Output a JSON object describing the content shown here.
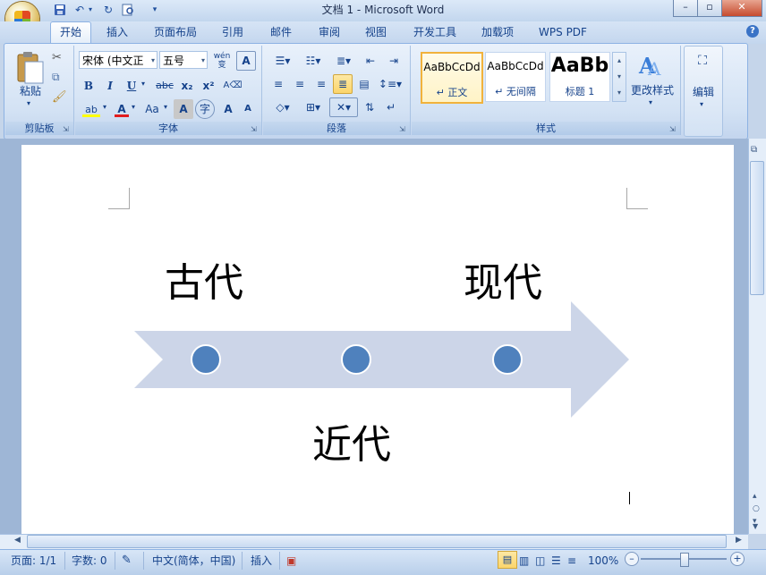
{
  "window": {
    "title": "文档 1 - Microsoft Word",
    "qat": [
      "save-icon",
      "undo-icon",
      "redo-icon",
      "print-preview-icon"
    ],
    "controls": [
      "minimize",
      "maximize",
      "close"
    ]
  },
  "tabs": [
    "开始",
    "插入",
    "页面布局",
    "引用",
    "邮件",
    "审阅",
    "视图",
    "开发工具",
    "加载项",
    "WPS PDF"
  ],
  "active_tab": "开始",
  "ribbon": {
    "clipboard": {
      "paste_label": "粘贴",
      "group_label": "剪贴板"
    },
    "font": {
      "font_name": "宋体 (中文正",
      "font_size": "五号",
      "wen_label": "wén 变",
      "bold": "B",
      "italic": "I",
      "underline": "U",
      "strike": "abc",
      "subscript": "x₂",
      "superscript": "x²",
      "aa_label": "Aa",
      "grow": "A",
      "shrink": "A",
      "group_label": "字体"
    },
    "paragraph": {
      "group_label": "段落"
    },
    "styles": {
      "items": [
        {
          "sample": "AaBbCcDd",
          "name": "↵ 正文"
        },
        {
          "sample": "AaBbCcDd",
          "name": "↵ 无间隔"
        },
        {
          "sample": "AaBb",
          "name": "标题 1"
        }
      ],
      "change_styles_label": "更改样式",
      "group_label": "样式"
    },
    "editing": {
      "label": "编辑"
    }
  },
  "document": {
    "labels": {
      "ancient": "古代",
      "modern_recent": "近代",
      "modern": "现代"
    },
    "arrow_color": "#ccd5e8",
    "dot_color": "#4f81bd"
  },
  "statusbar": {
    "page": "页面: 1/1",
    "words": "字数: 0",
    "language": "中文(简体，中国)",
    "mode": "插入",
    "zoom": "100%"
  }
}
